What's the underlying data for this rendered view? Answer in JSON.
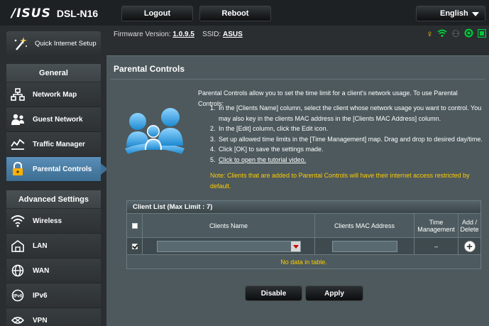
{
  "header": {
    "brand": "/ISUS",
    "model": "DSL-N16",
    "logout_label": "Logout",
    "reboot_label": "Reboot",
    "language": "English"
  },
  "firmware": {
    "label": "Firmware Version:",
    "version": "1.0.9.5",
    "ssid_label": "SSID:",
    "ssid": "ASUS"
  },
  "status_icons": [
    "usb-icon",
    "wifi-icon",
    "users-icon",
    "internet-icon",
    "app-icon"
  ],
  "sidebar": {
    "quick_setup": "Quick Internet Setup",
    "general_title": "General",
    "general_items": [
      {
        "label": "Network Map",
        "icon": "network-map-icon"
      },
      {
        "label": "Guest Network",
        "icon": "guest-network-icon"
      },
      {
        "label": "Traffic Manager",
        "icon": "traffic-manager-icon"
      },
      {
        "label": "Parental Controls",
        "icon": "parental-controls-icon",
        "active": true
      }
    ],
    "advanced_title": "Advanced Settings",
    "advanced_items": [
      {
        "label": "Wireless",
        "icon": "wireless-icon"
      },
      {
        "label": "LAN",
        "icon": "lan-icon"
      },
      {
        "label": "WAN",
        "icon": "wan-icon"
      },
      {
        "label": "IPv6",
        "icon": "ipv6-icon"
      },
      {
        "label": "VPN",
        "icon": "vpn-icon"
      }
    ]
  },
  "main": {
    "title": "Parental Controls",
    "description": "Parental Controls allow you to set the time limit for a client's network usage. To use Parental Controls:",
    "steps": [
      {
        "n": "1.",
        "text": "In the [Clients Name] column, select the client whose network usage you want to control. You may also key in the clients MAC address in the [Clients MAC Address] column."
      },
      {
        "n": "2.",
        "text": "In the [Edit] column, click the Edit icon."
      },
      {
        "n": "3.",
        "text": "Set up allowed time limits in the [Time Management] map. Drag and drop to desired day/time."
      },
      {
        "n": "4.",
        "text": "Click [OK] to save the settings made."
      },
      {
        "n": "5.",
        "text": "Click to open the tutorial video."
      }
    ],
    "note": "Note: Clients that are added to Parental Controls will have their internet access restricted by default."
  },
  "client_list": {
    "title": "Client List (Max Limit : 7)",
    "columns": [
      "Clients Name",
      "Clients MAC Address",
      "Time Management",
      "Add / Delete"
    ],
    "time_placeholder": "–",
    "empty_message": "No data in table."
  },
  "buttons": {
    "disable": "Disable",
    "apply": "Apply"
  }
}
